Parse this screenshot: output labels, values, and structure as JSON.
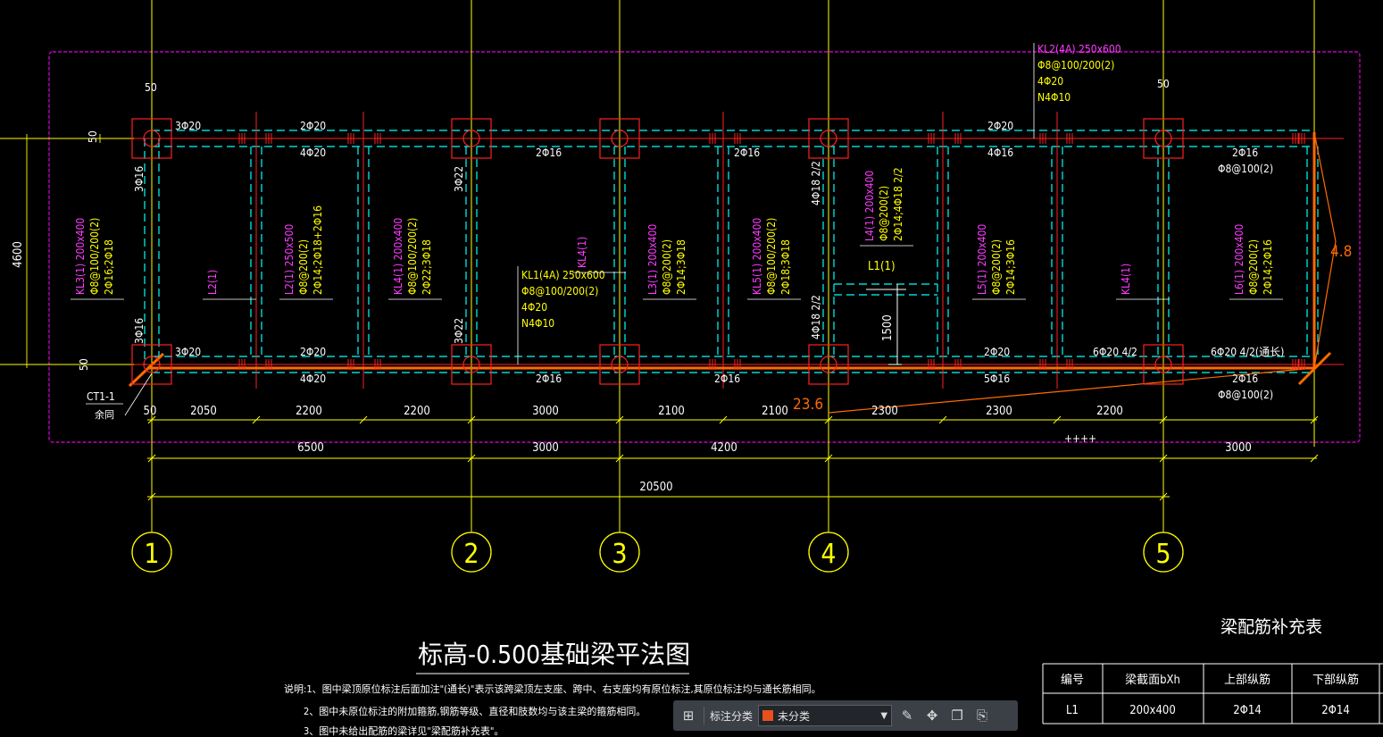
{
  "drawing": {
    "title": "标高-0.500基础梁平法图",
    "notes": [
      "说明:1、图中梁顶原位标注后面加注\"(通长)\"表示该跨梁顶左支座、跨中、右支座均有原位标注,其原位标注均与通长筋相同。",
      "2、图中未原位标注的附加箍筋,钢筋等级、直径和肢数均与该主梁的箍筋相同。",
      "3、图中未给出配筋的梁详见\"梁配筋补充表\"。"
    ],
    "axes": [
      "1",
      "2",
      "3",
      "4",
      "5"
    ],
    "span_dims": [
      "50",
      "2050",
      "2200",
      "2200",
      "3000",
      "2100",
      "2100",
      "2300",
      "2300",
      "2200"
    ],
    "group_dims": [
      "6500",
      "3000",
      "4200",
      "3000"
    ],
    "total_dim": "20500",
    "left_dims": {
      "overall": "4600",
      "top_offset": "50",
      "bottom_offset": "50"
    },
    "top_offsets": [
      "50",
      "50"
    ],
    "measure_labels": [
      "4.8",
      "23.6"
    ],
    "ct_label": "CT1-1",
    "ct_sub": "余同",
    "plus_marks": "++++",
    "kl2_annotation": [
      "KL2(4A) 250x600",
      "Φ8@100/200(2)",
      "4Φ20",
      "N4Φ10"
    ],
    "kl1_annotation": [
      "KL1(4A) 250x600",
      "Φ8@100/200(2)",
      "4Φ20",
      "N4Φ10"
    ],
    "top_rebar": [
      "3Φ20",
      "2Φ20",
      "4Φ20",
      "2Φ16",
      "2Φ16",
      "2Φ20",
      "4Φ16",
      "2Φ16",
      "Φ8@100(2)"
    ],
    "bottom_rebar": [
      "3Φ20",
      "2Φ20",
      "4Φ20",
      "2Φ16",
      "2Φ16",
      "2Φ20",
      "5Φ16",
      "6Φ20 4/2",
      "6Φ20 4/2(通长)",
      "2Φ16",
      "Φ8@100(2)"
    ],
    "vertical_beams": [
      {
        "name": "KL3(1) 200x400",
        "lines": [
          "Φ8@100/200(2)",
          "2Φ16;2Φ18"
        ]
      },
      {
        "name": "L2(1)",
        "lines": []
      },
      {
        "name": "L2(1) 250x500",
        "lines": [
          "Φ8@200(2)",
          "2Φ14;2Φ18+2Φ16"
        ]
      },
      {
        "name": "KL4(1) 200x400",
        "lines": [
          "Φ8@100/200(2)",
          "2Φ22;3Φ18"
        ]
      },
      {
        "name": "KL4(1)",
        "lines": []
      },
      {
        "name": "L3(1) 200x400",
        "lines": [
          "Φ8@200(2)",
          "2Φ14;3Φ18"
        ]
      },
      {
        "name": "KL5(1) 200x400",
        "lines": [
          "Φ8@100/200(2)",
          "2Φ18;3Φ18"
        ]
      },
      {
        "name": "L4(1) 200x400",
        "lines": [
          "Φ8@200(2)",
          "2Φ14;4Φ18 2/2"
        ]
      },
      {
        "name": "L5(1) 200x400",
        "lines": [
          "Φ8@200(2)",
          "2Φ14;3Φ16"
        ]
      },
      {
        "name": "KL4(1)",
        "lines": []
      },
      {
        "name": "L6(1) 200x400",
        "lines": [
          "Φ8@200(2)",
          "2Φ14;2Φ16"
        ]
      }
    ],
    "col_rebar": [
      "3Φ16",
      "3Φ16",
      "3Φ22",
      "3Φ22",
      "4Φ18 2/2",
      "4Φ18 2/2"
    ],
    "l1": {
      "label": "L1(1)",
      "dim": "1500"
    },
    "table": {
      "title": "梁配筋补充表",
      "headers": [
        "编号",
        "梁截面bXh",
        "上部纵筋",
        "下部纵筋"
      ],
      "rows": [
        [
          "L1",
          "200x400",
          "2Φ14",
          "2Φ14"
        ]
      ]
    }
  },
  "toolbar": {
    "label": "标注分类",
    "selected": "未分类",
    "swatch_color": "#e8501c"
  },
  "colors": {
    "background": "#000000",
    "axis": "#ffff00",
    "beam": "#00ffff",
    "beam_main": "#ff0000",
    "column": "#ff0000",
    "label_magenta": "#ff3cff",
    "label_yellow": "#ffff00",
    "measure": "#ff6a00",
    "border": "#c000c0",
    "text_white": "#e8e8e8"
  }
}
